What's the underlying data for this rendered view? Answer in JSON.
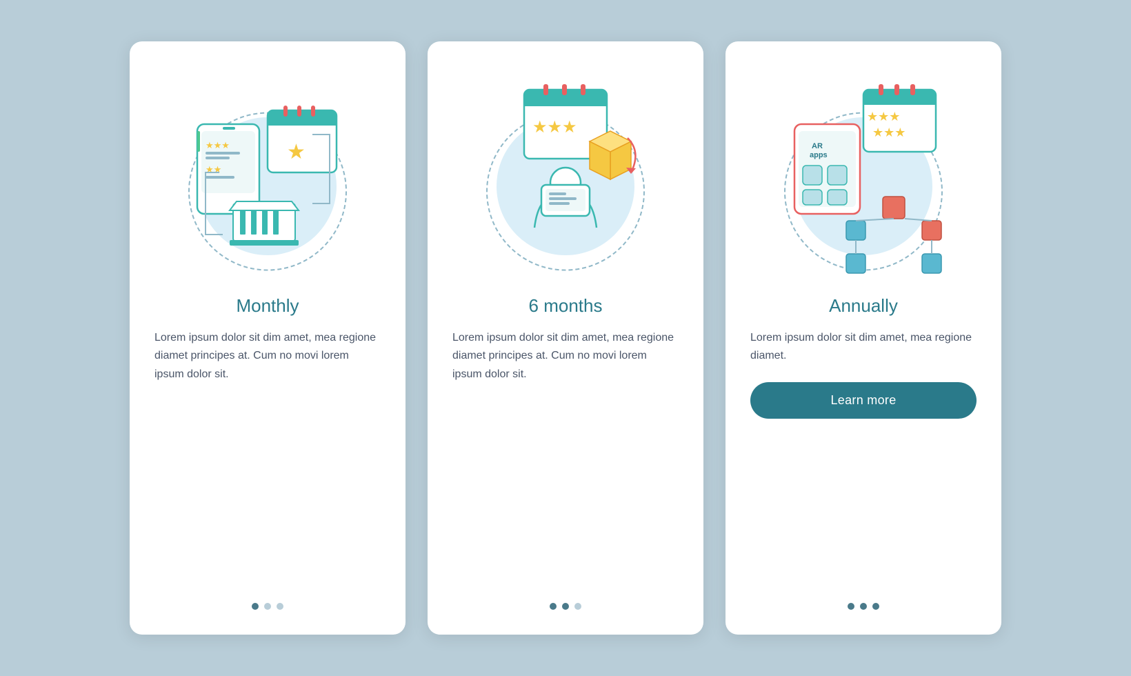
{
  "cards": [
    {
      "id": "monthly",
      "title": "Monthly",
      "text": "Lorem ipsum dolor sit dim amet, mea regione diamet principes at. Cum no movi lorem ipsum dolor sit.",
      "dots": [
        true,
        false,
        false
      ],
      "has_button": false,
      "button_label": ""
    },
    {
      "id": "6months",
      "title": "6 months",
      "text": "Lorem ipsum dolor sit dim amet, mea regione diamet principes at. Cum no movi lorem ipsum dolor sit.",
      "dots": [
        true,
        true,
        false
      ],
      "has_button": false,
      "button_label": ""
    },
    {
      "id": "annually",
      "title": "Annually",
      "text": "Lorem ipsum dolor sit dim amet, mea regione diamet.",
      "dots": [
        true,
        true,
        true
      ],
      "has_button": true,
      "button_label": "Learn more"
    }
  ],
  "colors": {
    "teal": "#2a7a8a",
    "light_blue": "#daeef8",
    "dashed": "#90b8c8",
    "star_yellow": "#f5c842",
    "star_teal": "#4ab8b8",
    "orange": "#e07040",
    "salmon": "#e87060",
    "coral": "#e86050"
  }
}
